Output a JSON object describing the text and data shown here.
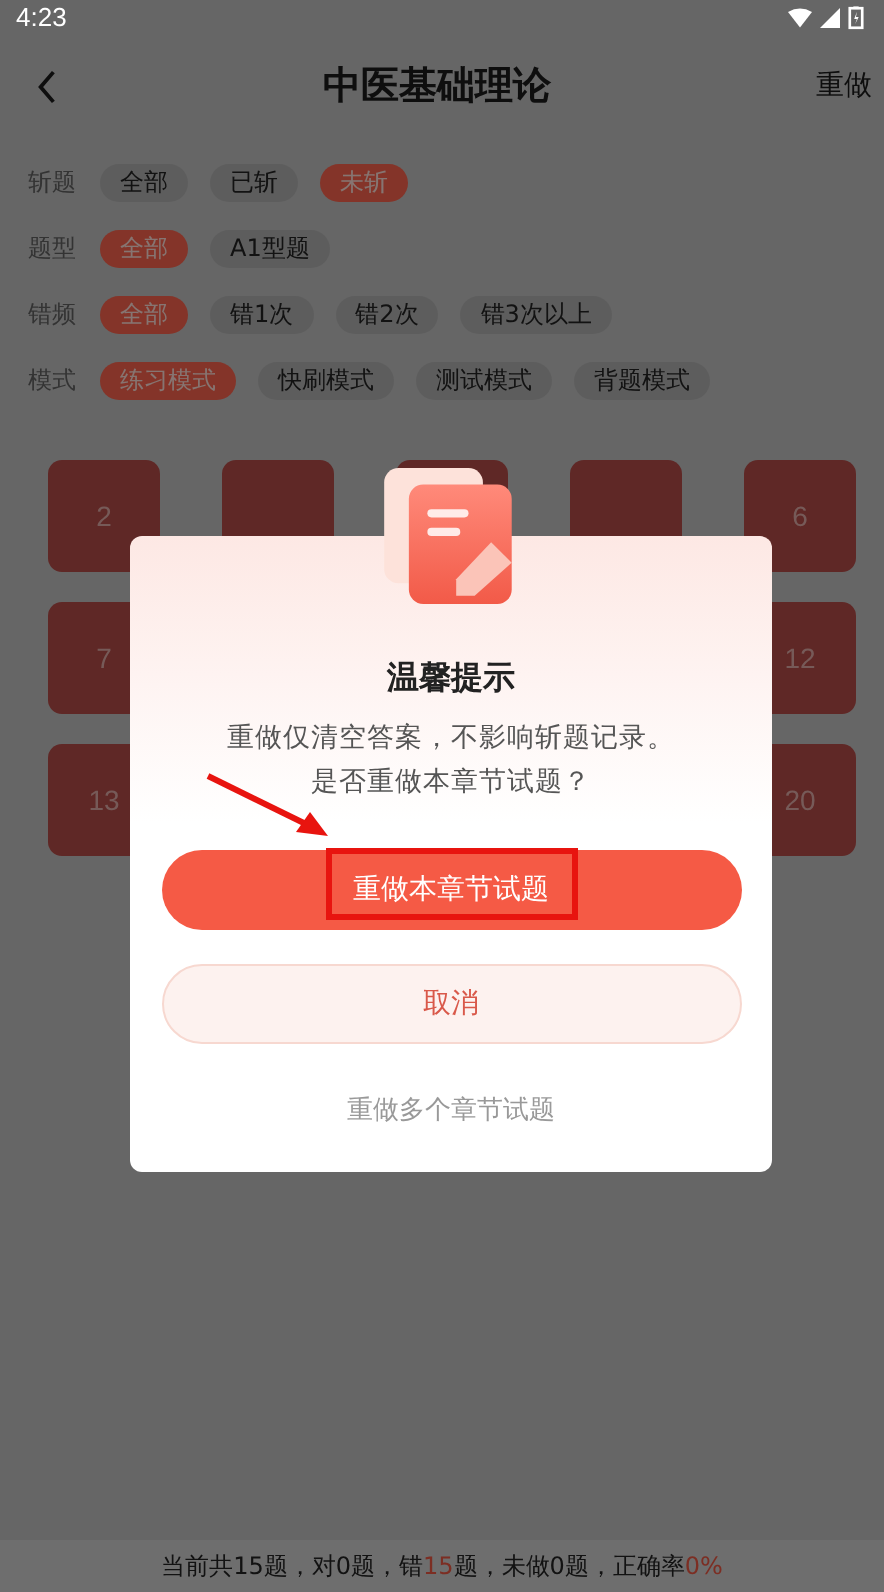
{
  "status_bar": {
    "time": "4:23"
  },
  "header": {
    "title": "中医基础理论",
    "action": "重做"
  },
  "filters": [
    {
      "label": "斩题",
      "options": [
        {
          "label": "全部",
          "selected": false
        },
        {
          "label": "已斩",
          "selected": false
        },
        {
          "label": "未斩",
          "selected": true
        }
      ]
    },
    {
      "label": "题型",
      "options": [
        {
          "label": "全部",
          "selected": true
        },
        {
          "label": "A1型题",
          "selected": false
        }
      ]
    },
    {
      "label": "错频",
      "options": [
        {
          "label": "全部",
          "selected": true
        },
        {
          "label": "错1次",
          "selected": false
        },
        {
          "label": "错2次",
          "selected": false
        },
        {
          "label": "错3次以上",
          "selected": false
        }
      ]
    },
    {
      "label": "模式",
      "options": [
        {
          "label": "练习模式",
          "selected": true
        },
        {
          "label": "快刷模式",
          "selected": false
        },
        {
          "label": "测试模式",
          "selected": false
        },
        {
          "label": "背题模式",
          "selected": false
        }
      ]
    }
  ],
  "grid": {
    "cells": [
      {
        "label": "2"
      },
      {},
      {},
      {},
      {
        "label": "6"
      },
      {
        "label": "7"
      },
      null,
      null,
      null,
      {
        "label": "12"
      },
      {
        "label": "13"
      },
      null,
      null,
      null,
      {
        "label": "20"
      }
    ]
  },
  "dialog": {
    "title": "温馨提示",
    "message_lines": [
      "重做仅清空答案，不影响斩题记录。",
      "是否重做本章节试题？"
    ],
    "primary_button": "重做本章节试题",
    "cancel_button": "取消",
    "link": "重做多个章节试题"
  },
  "summary": {
    "segments": [
      {
        "text": "当前共15题，对0题，错",
        "highlight": false
      },
      {
        "text": "15",
        "highlight": true
      },
      {
        "text": "题，未做0题，正确率",
        "highlight": false
      },
      {
        "text": "0%",
        "highlight": true
      }
    ]
  }
}
